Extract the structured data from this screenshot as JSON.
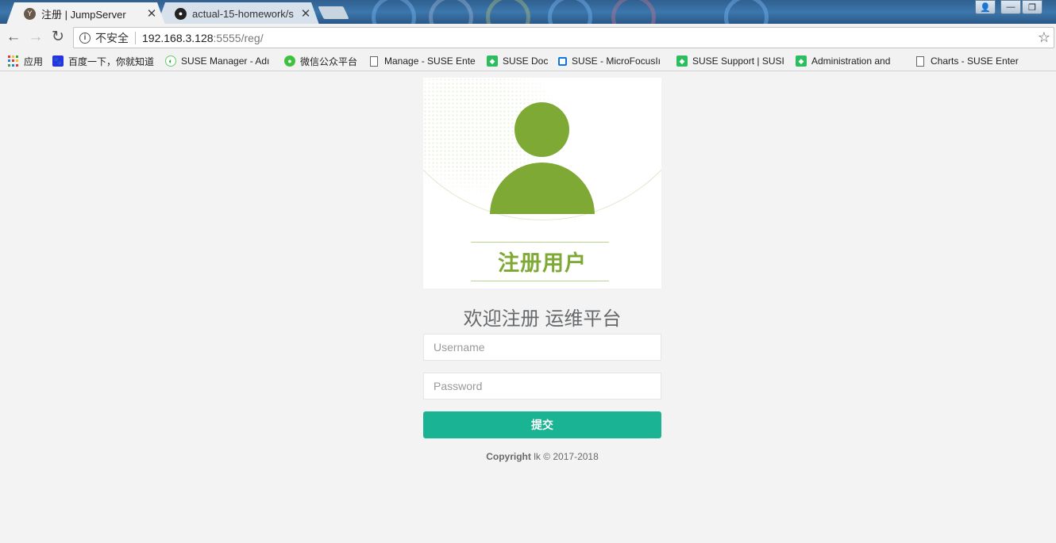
{
  "browser": {
    "tabs": [
      {
        "title": "注册 | JumpServer",
        "active": true,
        "favicon": "jumpserver-icon"
      },
      {
        "title": "actual-15-homework/s",
        "active": false,
        "favicon": "github-icon"
      }
    ],
    "address": {
      "security_label": "不安全",
      "host": "192.168.3.128",
      "path": ":5555/reg/"
    },
    "bookmarks": [
      {
        "label": "应用",
        "icon": "apps-grid-icon"
      },
      {
        "label": "百度一下，你就知道",
        "icon": "baidu-paw-icon"
      },
      {
        "label": "SUSE Manager - Adı",
        "icon": "suse-manager-icon"
      },
      {
        "label": "微信公众平台",
        "icon": "wechat-icon"
      },
      {
        "label": "Manage - SUSE Ente",
        "icon": "page-icon"
      },
      {
        "label": "SUSE Doc",
        "icon": "suse-chameleon-icon"
      },
      {
        "label": "SUSE - MicroFocusIı",
        "icon": "microfocus-icon"
      },
      {
        "label": "SUSE Support | SUSI",
        "icon": "suse-chameleon-icon"
      },
      {
        "label": "Administration and",
        "icon": "suse-chameleon-icon"
      },
      {
        "label": "Charts - SUSE Enter",
        "icon": "page-icon"
      }
    ]
  },
  "page": {
    "hero_title": "注册用户",
    "welcome": "欢迎注册 运维平台",
    "username_placeholder": "Username",
    "password_placeholder": "Password",
    "submit_label": "提交",
    "copyright_bold": "Copyright",
    "copyright_rest": " lk © 2017-2018"
  },
  "colors": {
    "accent": "#1ab394",
    "hero_green": "#7fa935",
    "background": "#f3f3f4"
  }
}
